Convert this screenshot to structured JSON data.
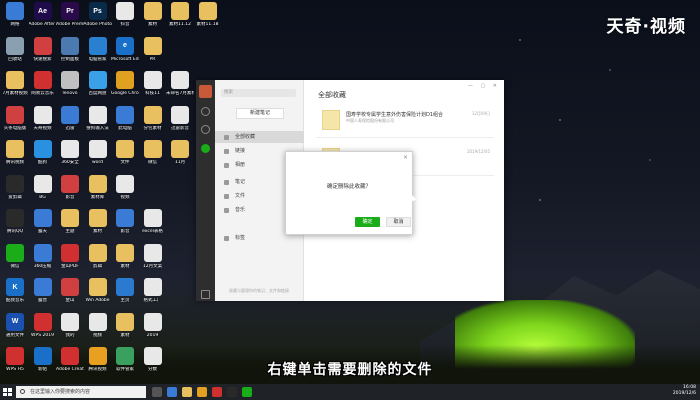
{
  "watermark": "天奇·视频",
  "subtitle": "右键单击需要删除的文件",
  "desktop_icons": [
    {
      "label": "网络",
      "color": "#3a7bd5",
      "glyph": "",
      "col": 0,
      "row": 0
    },
    {
      "label": "Adobe After Effects CC ...",
      "color": "#1f0a4a",
      "glyph": "Ae",
      "col": 1,
      "row": 0
    },
    {
      "label": "Adobe Premiere P...",
      "color": "#2a0a4a",
      "glyph": "Pr",
      "col": 2,
      "row": 0
    },
    {
      "label": "Adobe Photosh...",
      "color": "#0a2a4a",
      "glyph": "Ps",
      "col": 3,
      "row": 0
    },
    {
      "label": "抖音",
      "color": "#e8e8e8",
      "glyph": "",
      "col": 4,
      "row": 0
    },
    {
      "label": "素材",
      "color": "#e8c060",
      "glyph": "",
      "col": 5,
      "row": 0
    },
    {
      "label": "素材11.12",
      "color": "#e8c060",
      "glyph": "",
      "col": 6,
      "row": 0
    },
    {
      "label": "素材11.18",
      "color": "#e8c060",
      "glyph": "",
      "col": 7,
      "row": 0
    },
    {
      "label": "回收站",
      "color": "#8aa0b0",
      "glyph": "",
      "col": 0,
      "row": 1
    },
    {
      "label": "快速搜索",
      "color": "#d04040",
      "glyph": "",
      "col": 1,
      "row": 1
    },
    {
      "label": "控制面板",
      "color": "#4a7ab0",
      "glyph": "",
      "col": 2,
      "row": 1
    },
    {
      "label": "电脑管家",
      "color": "#2a80d0",
      "glyph": "",
      "col": 3,
      "row": 1
    },
    {
      "label": "Microsoft Edge",
      "color": "#1a70c8",
      "glyph": "e",
      "col": 4,
      "row": 1
    },
    {
      "label": "PR",
      "color": "#e8c060",
      "glyph": "",
      "col": 5,
      "row": 1
    },
    {
      "label": "7月素材视频",
      "color": "#e8c060",
      "glyph": "",
      "col": 0,
      "row": 2
    },
    {
      "label": "网易云音乐",
      "color": "#d03030",
      "glyph": "",
      "col": 1,
      "row": 2
    },
    {
      "label": "lenovo",
      "color": "#c0c0c0",
      "glyph": "",
      "col": 2,
      "row": 2
    },
    {
      "label": "百度网盘",
      "color": "#3aa0e8",
      "glyph": "",
      "col": 3,
      "row": 2
    },
    {
      "label": "Google Chrome",
      "color": "#e0a020",
      "glyph": "",
      "col": 4,
      "row": 2
    },
    {
      "label": "科技11",
      "color": "#e8e8e8",
      "glyph": "",
      "col": 5,
      "row": 2
    },
    {
      "label": "未命名7月素材",
      "color": "#e8e8e8",
      "glyph": "",
      "col": 6,
      "row": 2
    },
    {
      "label": "头条电脑版",
      "color": "#d04040",
      "glyph": "",
      "col": 0,
      "row": 3
    },
    {
      "label": "天奇视频",
      "color": "#e8e8e8",
      "glyph": "",
      "col": 1,
      "row": 3
    },
    {
      "label": "迅雷",
      "color": "#3a7bd5",
      "glyph": "",
      "col": 2,
      "row": 3
    },
    {
      "label": "搜狗输入法",
      "color": "#e8e8e8",
      "glyph": "",
      "col": 3,
      "row": 3
    },
    {
      "label": "此电脑",
      "color": "#3a7bd5",
      "glyph": "",
      "col": 4,
      "row": 3
    },
    {
      "label": "分包素材",
      "color": "#e8c060",
      "glyph": "",
      "col": 5,
      "row": 3
    },
    {
      "label": "迅雷影音",
      "color": "#e8e8e8",
      "glyph": "",
      "col": 6,
      "row": 3
    },
    {
      "label": "腾讯视频",
      "color": "#e8c060",
      "glyph": "",
      "col": 0,
      "row": 4
    },
    {
      "label": "酷狗",
      "color": "#2a90e0",
      "glyph": "",
      "col": 1,
      "row": 4
    },
    {
      "label": "360安全",
      "color": "#e8e8e8",
      "glyph": "",
      "col": 2,
      "row": 4
    },
    {
      "label": "word",
      "color": "#e8e8e8",
      "glyph": "",
      "col": 3,
      "row": 4
    },
    {
      "label": "文件",
      "color": "#e8c060",
      "glyph": "",
      "col": 4,
      "row": 4
    },
    {
      "label": "微信",
      "color": "#e8c060",
      "glyph": "",
      "col": 5,
      "row": 4
    },
    {
      "label": "11月",
      "color": "#e8c060",
      "glyph": "",
      "col": 6,
      "row": 4
    },
    {
      "label": "爱剪辑",
      "color": "#2a2a2a",
      "glyph": "",
      "col": 0,
      "row": 5
    },
    {
      "label": "BG",
      "color": "#e8e8e8",
      "glyph": "",
      "col": 1,
      "row": 5
    },
    {
      "label": "影音",
      "color": "#d04040",
      "glyph": "",
      "col": 2,
      "row": 5
    },
    {
      "label": "素材库",
      "color": "#e8c060",
      "glyph": "",
      "col": 3,
      "row": 5
    },
    {
      "label": "视频",
      "color": "#e8e8e8",
      "glyph": "",
      "col": 4,
      "row": 5
    },
    {
      "label": "腾讯QQ",
      "color": "#2a2a2a",
      "glyph": "",
      "col": 0,
      "row": 6
    },
    {
      "label": "露天",
      "color": "#3a7bd5",
      "glyph": "",
      "col": 1,
      "row": 6
    },
    {
      "label": "主题",
      "color": "#e8c060",
      "glyph": "",
      "col": 2,
      "row": 6
    },
    {
      "label": "素材",
      "color": "#e8c060",
      "glyph": "",
      "col": 3,
      "row": 6
    },
    {
      "label": "影音",
      "color": "#3a7bd5",
      "glyph": "",
      "col": 4,
      "row": 6
    },
    {
      "label": "excel表格",
      "color": "#e8e8e8",
      "glyph": "",
      "col": 5,
      "row": 6
    },
    {
      "label": "微信",
      "color": "#1aad19",
      "glyph": "",
      "col": 0,
      "row": 7
    },
    {
      "label": "360压缩",
      "color": "#3a7bd5",
      "glyph": "",
      "col": 1,
      "row": 7
    },
    {
      "label": "金山PDF",
      "color": "#d03030",
      "glyph": "",
      "col": 2,
      "row": 7
    },
    {
      "label": "剪辑",
      "color": "#e8c060",
      "glyph": "",
      "col": 3,
      "row": 7
    },
    {
      "label": "素材",
      "color": "#e8c060",
      "glyph": "",
      "col": 4,
      "row": 7
    },
    {
      "label": "12月文案",
      "color": "#e8e8e8",
      "glyph": "",
      "col": 5,
      "row": 7
    },
    {
      "label": "酷我音乐",
      "color": "#1a70c8",
      "glyph": "K",
      "col": 0,
      "row": 8
    },
    {
      "label": "露营",
      "color": "#3a7bd5",
      "glyph": "",
      "col": 1,
      "row": 8
    },
    {
      "label": "金山",
      "color": "#d04040",
      "glyph": "",
      "col": 2,
      "row": 8
    },
    {
      "label": "Win Adobe",
      "color": "#e8c060",
      "glyph": "",
      "col": 3,
      "row": 8
    },
    {
      "label": "主页",
      "color": "#2a7ad0",
      "glyph": "",
      "col": 4,
      "row": 8
    },
    {
      "label": "格式工厂",
      "color": "#e8e8e8",
      "glyph": "",
      "col": 5,
      "row": 8
    },
    {
      "label": "通用文件",
      "color": "#1a50b0",
      "glyph": "W",
      "col": 0,
      "row": 9
    },
    {
      "label": "WPS 2019",
      "color": "#d03030",
      "glyph": "",
      "col": 1,
      "row": 9
    },
    {
      "label": "我的",
      "color": "#e8e8e8",
      "glyph": "",
      "col": 2,
      "row": 9
    },
    {
      "label": "视频",
      "color": "#e8e8e8",
      "glyph": "",
      "col": 3,
      "row": 9
    },
    {
      "label": "素材",
      "color": "#e8c060",
      "glyph": "",
      "col": 4,
      "row": 9
    },
    {
      "label": "2019",
      "color": "#e8e8e8",
      "glyph": "",
      "col": 5,
      "row": 9
    },
    {
      "label": "WPS H5",
      "color": "#d03030",
      "glyph": "",
      "col": 0,
      "row": 10
    },
    {
      "label": "新帖",
      "color": "#1a70c8",
      "glyph": "",
      "col": 1,
      "row": 10
    },
    {
      "label": "Adobe Creati...",
      "color": "#d03030",
      "glyph": "",
      "col": 2,
      "row": 10
    },
    {
      "label": "腾讯视频",
      "color": "#e8a020",
      "glyph": "",
      "col": 3,
      "row": 10
    },
    {
      "label": "软件管家",
      "color": "#3aa060",
      "glyph": "",
      "col": 4,
      "row": 10
    },
    {
      "label": "分数",
      "color": "#e8e8e8",
      "glyph": "",
      "col": 5,
      "row": 10
    }
  ],
  "app": {
    "search_placeholder": "搜索",
    "new_note_label": "新建笔记",
    "sidebar_items": [
      {
        "label": "全部收藏",
        "active": true
      },
      {
        "label": "链接",
        "active": false
      },
      {
        "label": "相册",
        "active": false
      },
      {
        "label": "笔记",
        "active": false
      },
      {
        "label": "文件",
        "active": false
      },
      {
        "label": "音乐",
        "active": false
      },
      {
        "label": "标签",
        "active": false
      }
    ],
    "sidebar_footer": "收藏与管理你的笔记、文件和链接",
    "main_title": "全部收藏",
    "favorites": [
      {
        "title": "国寿学校专属学生意外伤害保险计划D1组合",
        "subtitle": "中国人寿保险股份有限公司",
        "date": "12月09日"
      },
      {
        "title": "",
        "subtitle": "中国人寿保险股份有限公司",
        "date": "2019/12/05"
      }
    ]
  },
  "dialog": {
    "message": "确定删除此收藏？",
    "ok_label": "确定",
    "cancel_label": "取消"
  },
  "taskbar": {
    "search_placeholder": "在这里输入你要搜索的内容",
    "time": "16:08",
    "date": "2019/12/6"
  }
}
